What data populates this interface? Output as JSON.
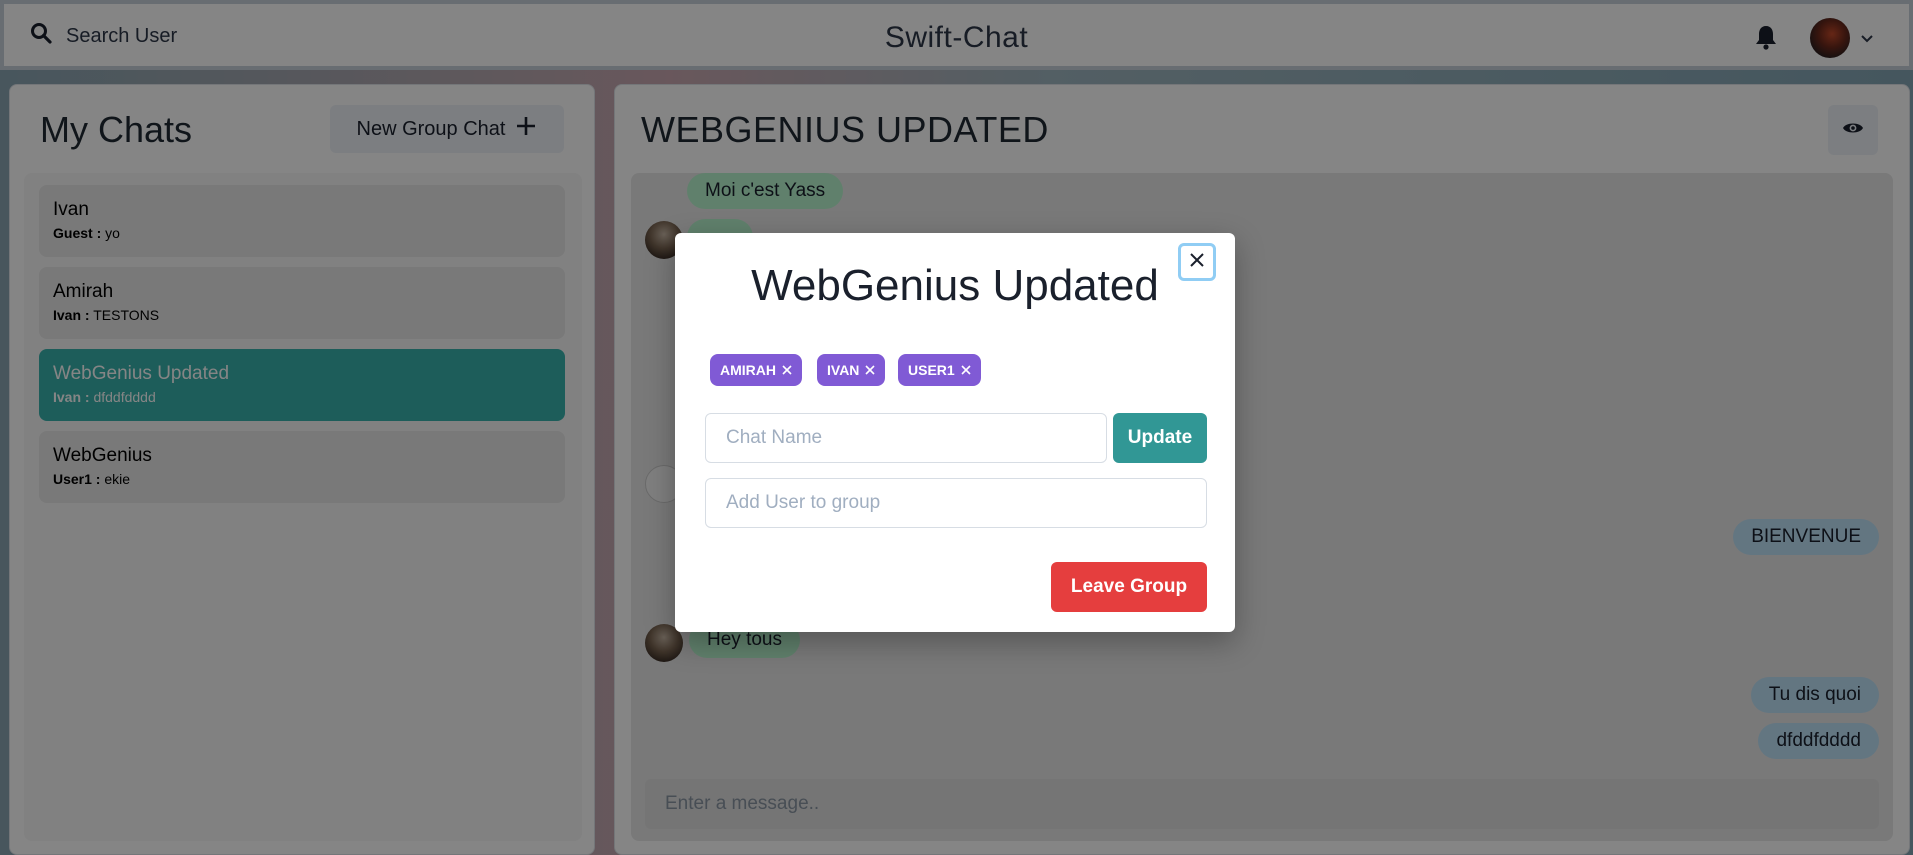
{
  "header": {
    "search_label": "Search User",
    "app_title": "Swift-Chat"
  },
  "sidebar": {
    "title": "My Chats",
    "new_group_label": "New Group Chat",
    "chats": [
      {
        "name": "Ivan",
        "sender": "Guest :",
        "last": "yo",
        "active": false
      },
      {
        "name": "Amirah",
        "sender": "Ivan :",
        "last": "TESTONS",
        "active": false
      },
      {
        "name": "WebGenius Updated",
        "sender": "Ivan :",
        "last": "dfddfdddd",
        "active": true
      },
      {
        "name": "WebGenius",
        "sender": "User1 :",
        "last": "ekie",
        "active": false
      }
    ]
  },
  "conversation": {
    "title": "WEBGENIUS UPDATED",
    "messages": [
      {
        "text": "Moi c'est Yass",
        "from": "them"
      },
      {
        "text": "BIENVENUE",
        "from": "me"
      },
      {
        "text": "Hey tous",
        "from": "them"
      },
      {
        "text": "Tu dis quoi",
        "from": "me"
      },
      {
        "text": "dfddfdddd",
        "from": "me"
      }
    ],
    "input_placeholder": "Enter a message.."
  },
  "modal": {
    "title": "WebGenius Updated",
    "members": [
      "AMIRAH",
      "IVAN",
      "USER1"
    ],
    "chat_name_placeholder": "Chat Name",
    "update_label": "Update",
    "add_user_placeholder": "Add User to group",
    "leave_label": "Leave Group"
  },
  "colors": {
    "active_chat": "#38b2ac",
    "badge": "#805ad5",
    "update_button": "#319795",
    "leave_button": "#e53e3e",
    "bubble_them": "#b9f5d0",
    "bubble_me": "#bee3f8"
  }
}
